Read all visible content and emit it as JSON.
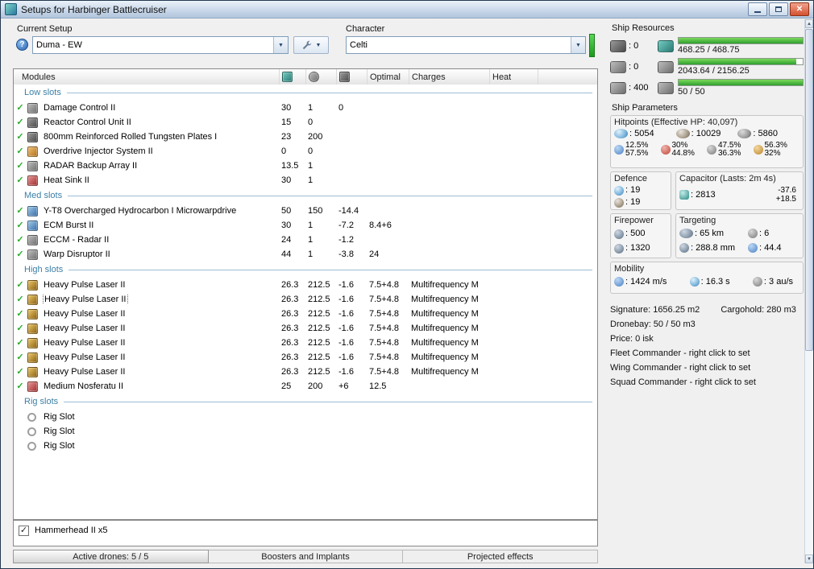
{
  "window": {
    "title": "Setups for Harbinger Battlecruiser",
    "icon": "app-icon",
    "controls": [
      "minimize-button",
      "maximize-button",
      "close-button"
    ]
  },
  "colors": {
    "bar_green": "#3aa52f",
    "section_header_blue": "#3c7fa5",
    "check_green": "#2cab2c",
    "close_button_red": "#d4512f",
    "skill_indicator_green": "#2fbf2f"
  },
  "toolbar": {
    "current_setup": {
      "label": "Current Setup",
      "value": "Duma - EW",
      "help_icon": "help-icon",
      "tools_icon": "wrench-icon"
    },
    "character": {
      "label": "Character",
      "value": "Celti"
    }
  },
  "ship_resources": {
    "title": "Ship Resources",
    "hardpoints": [
      {
        "icon": "turret-hardpoint-icon",
        "value": "0"
      },
      {
        "icon": "launcher-hardpoint-icon",
        "value": "0"
      },
      {
        "icon": "calibration-icon",
        "value": "400"
      }
    ],
    "bars": [
      {
        "icon": "cpu-icon",
        "text": "468.25 / 468.75",
        "pct": 99.9
      },
      {
        "icon": "powergrid-icon",
        "text": "2043.64 / 2156.25",
        "pct": 94.8
      },
      {
        "icon": "dronebay-icon",
        "text": "50 / 50",
        "pct": 100
      }
    ]
  },
  "modules_table": {
    "header": {
      "modules": "Modules",
      "cpu_icon": "cpu-icon",
      "pg_icon": "powergrid-icon",
      "cap_icon": "capacitor-icon",
      "optimal": "Optimal",
      "charges": "Charges",
      "heat": "Heat"
    },
    "sections": [
      {
        "name": "Low slots",
        "rows": [
          {
            "check": true,
            "icon": "damage-control-icon",
            "name": "Damage Control II",
            "cpu": "30",
            "pg": "1",
            "cap": "0",
            "optimal": "",
            "charges": "",
            "heat": ""
          },
          {
            "check": true,
            "icon": "reactor-control-icon",
            "name": "Reactor Control Unit II",
            "cpu": "15",
            "pg": "0",
            "cap": "",
            "optimal": "",
            "charges": "",
            "heat": ""
          },
          {
            "check": true,
            "icon": "armor-plate-icon",
            "name": "800mm Reinforced Rolled Tungsten Plates I",
            "cpu": "23",
            "pg": "200",
            "cap": "",
            "optimal": "",
            "charges": "",
            "heat": ""
          },
          {
            "check": true,
            "icon": "overdrive-icon",
            "name": "Overdrive Injector System II",
            "cpu": "0",
            "pg": "0",
            "cap": "",
            "optimal": "",
            "charges": "",
            "heat": ""
          },
          {
            "check": true,
            "icon": "backup-array-icon",
            "name": "RADAR Backup Array II",
            "cpu": "13.5",
            "pg": "1",
            "cap": "",
            "optimal": "",
            "charges": "",
            "heat": ""
          },
          {
            "check": true,
            "icon": "heat-sink-icon",
            "name": "Heat Sink II",
            "cpu": "30",
            "pg": "1",
            "cap": "",
            "optimal": "",
            "charges": "",
            "heat": ""
          }
        ]
      },
      {
        "name": "Med slots",
        "rows": [
          {
            "check": true,
            "icon": "mwd-icon",
            "name": "Y-T8 Overcharged Hydrocarbon I Microwarpdrive",
            "cpu": "50",
            "pg": "150",
            "cap": "-14.4",
            "optimal": "",
            "charges": "",
            "heat": ""
          },
          {
            "check": true,
            "icon": "ecm-burst-icon",
            "name": "ECM Burst II",
            "cpu": "30",
            "pg": "1",
            "cap": "-7.2",
            "optimal": "8.4+6",
            "charges": "",
            "heat": ""
          },
          {
            "check": true,
            "icon": "eccm-icon",
            "name": "ECCM - Radar II",
            "cpu": "24",
            "pg": "1",
            "cap": "-1.2",
            "optimal": "",
            "charges": "",
            "heat": ""
          },
          {
            "check": true,
            "icon": "warp-disruptor-icon",
            "name": "Warp Disruptor II",
            "cpu": "44",
            "pg": "1",
            "cap": "-3.8",
            "optimal": "24",
            "charges": "",
            "heat": ""
          }
        ]
      },
      {
        "name": "High slots",
        "rows": [
          {
            "check": true,
            "icon": "pulse-laser-icon",
            "name": "Heavy Pulse Laser II",
            "cpu": "26.3",
            "pg": "212.5",
            "cap": "-1.6",
            "optimal": "7.5+4.8",
            "charges": "Multifrequency M",
            "heat": ""
          },
          {
            "check": true,
            "focused": true,
            "icon": "pulse-laser-icon",
            "name": "Heavy Pulse Laser II",
            "cpu": "26.3",
            "pg": "212.5",
            "cap": "-1.6",
            "optimal": "7.5+4.8",
            "charges": "Multifrequency M",
            "heat": ""
          },
          {
            "check": true,
            "icon": "pulse-laser-icon",
            "name": "Heavy Pulse Laser II",
            "cpu": "26.3",
            "pg": "212.5",
            "cap": "-1.6",
            "optimal": "7.5+4.8",
            "charges": "Multifrequency M",
            "heat": ""
          },
          {
            "check": true,
            "icon": "pulse-laser-icon",
            "name": "Heavy Pulse Laser II",
            "cpu": "26.3",
            "pg": "212.5",
            "cap": "-1.6",
            "optimal": "7.5+4.8",
            "charges": "Multifrequency M",
            "heat": ""
          },
          {
            "check": true,
            "icon": "pulse-laser-icon",
            "name": "Heavy Pulse Laser II",
            "cpu": "26.3",
            "pg": "212.5",
            "cap": "-1.6",
            "optimal": "7.5+4.8",
            "charges": "Multifrequency M",
            "heat": ""
          },
          {
            "check": true,
            "icon": "pulse-laser-icon",
            "name": "Heavy Pulse Laser II",
            "cpu": "26.3",
            "pg": "212.5",
            "cap": "-1.6",
            "optimal": "7.5+4.8",
            "charges": "Multifrequency M",
            "heat": ""
          },
          {
            "check": true,
            "icon": "pulse-laser-icon",
            "name": "Heavy Pulse Laser II",
            "cpu": "26.3",
            "pg": "212.5",
            "cap": "-1.6",
            "optimal": "7.5+4.8",
            "charges": "Multifrequency M",
            "heat": ""
          },
          {
            "check": true,
            "icon": "nosferatu-icon",
            "name": "Medium Nosferatu II",
            "cpu": "25",
            "pg": "200",
            "cap": "+6",
            "optimal": "12.5",
            "charges": "",
            "heat": ""
          }
        ]
      },
      {
        "name": "Rig slots",
        "rows": [
          {
            "check": false,
            "icon": "rig-slot-icon",
            "name": "Rig Slot",
            "cpu": "",
            "pg": "",
            "cap": "",
            "optimal": "",
            "charges": "",
            "heat": ""
          },
          {
            "check": false,
            "icon": "rig-slot-icon",
            "name": "Rig Slot",
            "cpu": "",
            "pg": "",
            "cap": "",
            "optimal": "",
            "charges": "",
            "heat": ""
          },
          {
            "check": false,
            "icon": "rig-slot-icon",
            "name": "Rig Slot",
            "cpu": "",
            "pg": "",
            "cap": "",
            "optimal": "",
            "charges": "",
            "heat": ""
          }
        ]
      }
    ]
  },
  "drone_bay": {
    "items": [
      {
        "checked": true,
        "label": "Hammerhead II x5"
      }
    ]
  },
  "bottom_tabs": [
    {
      "label": "Active drones: 5 / 5",
      "active": true
    },
    {
      "label": "Boosters and Implants",
      "active": false
    },
    {
      "label": "Projected effects",
      "active": false
    }
  ],
  "ship_parameters": {
    "title": "Ship Parameters",
    "hitpoints": {
      "title": "Hitpoints (Effective HP: 40,097)",
      "shield": {
        "icon": "shield-icon",
        "value": "5054"
      },
      "armor": {
        "icon": "armor-icon",
        "value": "10029"
      },
      "structure": {
        "icon": "structure-icon",
        "value": "5860"
      },
      "resists": [
        {
          "icon": "em-resist-icon",
          "shield": "12.5%",
          "armor": "57.5%"
        },
        {
          "icon": "thermal-resist-icon",
          "shield": "30%",
          "armor": "44.8%"
        },
        {
          "icon": "kinetic-resist-icon",
          "shield": "47.5%",
          "armor": "36.3%"
        },
        {
          "icon": "explosive-resist-icon",
          "shield": "56.3%",
          "armor": "32%"
        }
      ]
    },
    "defence": {
      "title": "Defence",
      "rows": [
        {
          "icon": "shield-defence-icon",
          "value": "19"
        },
        {
          "icon": "armor-defence-icon",
          "value": "19"
        }
      ]
    },
    "capacitor": {
      "title": "Capacitor (Lasts: 2m 4s)",
      "capacity": {
        "icon": "capacitor-icon",
        "value": "2813"
      },
      "drain": "-37.6",
      "recharge": "+18.5"
    },
    "firepower": {
      "title": "Firepower",
      "rows": [
        {
          "icon": "turret-icon",
          "value": "500"
        },
        {
          "icon": "dps-icon",
          "value": "1320"
        }
      ]
    },
    "targeting": {
      "title": "Targeting",
      "cells": [
        {
          "icon": "targeting-range-icon",
          "value": "65 km"
        },
        {
          "icon": "max-targets-icon",
          "value": "6"
        },
        {
          "icon": "scan-resolution-icon",
          "value": "288.8 mm"
        },
        {
          "icon": "sensor-strength-icon",
          "value": "44.4"
        }
      ]
    },
    "mobility": {
      "title": "Mobility",
      "cells": [
        {
          "icon": "speed-icon",
          "value": "1424 m/s"
        },
        {
          "icon": "align-time-icon",
          "value": "16.3 s"
        },
        {
          "icon": "warp-speed-icon",
          "value": "3 au/s"
        }
      ]
    },
    "info_lines": [
      [
        "Signature: 1656.25 m2",
        "Cargohold: 280 m3"
      ],
      [
        "Dronebay: 50 / 50 m3"
      ],
      [
        "Price: 0 isk"
      ],
      [
        "Fleet Commander - right click to set"
      ],
      [
        "Wing Commander - right click to set"
      ],
      [
        "Squad Commander - right click to set"
      ]
    ]
  }
}
